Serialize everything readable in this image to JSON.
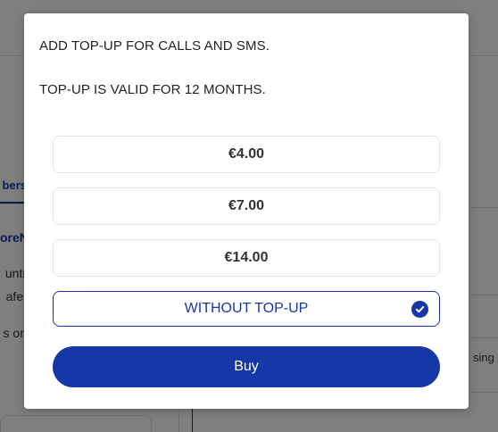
{
  "background": {
    "tab_label": "bers",
    "link_text": "oreN",
    "text_line_1": "untr",
    "text_line_2": "afe.",
    "text_line_3": "s on",
    "right_text": "sing N"
  },
  "modal": {
    "line1": "ADD TOP-UP FOR CALLS AND SMS.",
    "line2": "TOP-UP IS VALID FOR 12 MONTHS.",
    "options": [
      {
        "label": "€4.00",
        "selected": false
      },
      {
        "label": "€7.00",
        "selected": false
      },
      {
        "label": "€14.00",
        "selected": false
      },
      {
        "label": "WITHOUT TOP-UP",
        "selected": true
      }
    ],
    "buy_label": "Buy"
  },
  "colors": {
    "accent": "#1637a8",
    "overlay": "rgba(0,0,0,0.5)"
  },
  "icons": {
    "selected_indicator": "check-circle-icon"
  }
}
